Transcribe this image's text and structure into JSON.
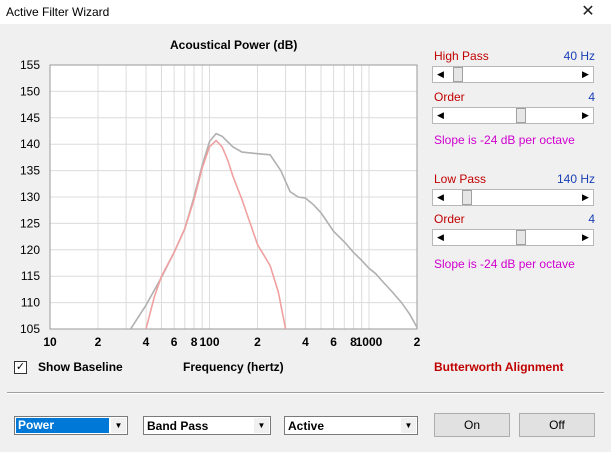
{
  "window": {
    "title": "Active Filter Wizard",
    "close_glyph": "✕"
  },
  "chart_data": {
    "type": "line",
    "title": "Acoustical Power (dB)",
    "xlabel": "Frequency (hertz)",
    "ylabel": "",
    "x_scale": "log",
    "xlim": [
      10,
      2000
    ],
    "ylim": [
      105,
      155
    ],
    "x_ticks": [
      10,
      20,
      40,
      60,
      80,
      100,
      200,
      400,
      600,
      800,
      1000,
      2000
    ],
    "x_tick_labels": [
      "10",
      "2",
      "4",
      "6",
      "8",
      "100",
      "2",
      "4",
      "6",
      "8",
      "1000",
      "2"
    ],
    "y_ticks": [
      105,
      110,
      115,
      120,
      125,
      130,
      135,
      140,
      145,
      150,
      155
    ],
    "grid": true,
    "series": [
      {
        "color": "#b0b0b0",
        "x": [
          32,
          40,
          50,
          60,
          70,
          80,
          90,
          100,
          110,
          120,
          140,
          160,
          200,
          240,
          280,
          320,
          360,
          400,
          450,
          500,
          600,
          700,
          800,
          900,
          1000,
          1100,
          1200,
          1400,
          1600,
          1800,
          2000
        ],
        "y": [
          105,
          109.5,
          114.8,
          119.5,
          124,
          130,
          136,
          140.5,
          142,
          141.5,
          139.5,
          138.5,
          138.2,
          138,
          135,
          131,
          130,
          129.8,
          128.5,
          127,
          123.5,
          121.5,
          119.5,
          118,
          116.5,
          115.5,
          114.2,
          112,
          110,
          107.8,
          105.3
        ]
      },
      {
        "color": "#f0a0a0",
        "x": [
          40,
          45,
          50,
          60,
          70,
          80,
          90,
          100,
          110,
          120,
          130,
          140,
          160,
          180,
          200,
          240,
          270,
          300
        ],
        "y": [
          105,
          111,
          115,
          119.5,
          124,
          129.5,
          135.5,
          139.5,
          140.7,
          139.5,
          137,
          134,
          129.5,
          125,
          121,
          117,
          112,
          105
        ]
      }
    ]
  },
  "controls": {
    "high_pass": {
      "label": "High Pass",
      "value": "40 Hz",
      "position": 0.045
    },
    "high_order": {
      "label": "Order",
      "value": "4",
      "position": 0.57
    },
    "high_slope": "Slope is -24 dB per octave",
    "low_pass": {
      "label": "Low Pass",
      "value": "140 Hz",
      "position": 0.12
    },
    "low_order": {
      "label": "Order",
      "value": "4",
      "position": 0.57
    },
    "low_slope": "Slope is -24 dB per octave"
  },
  "options": {
    "show_baseline_label": "Show Baseline",
    "show_baseline_checked": true,
    "check_glyph": "✓",
    "alignment": "Butterworth Alignment"
  },
  "bottom": {
    "combo1": "Power",
    "combo2": "Band Pass",
    "combo3": "Active",
    "on_label": "On",
    "off_label": "Off",
    "drop_glyph": "▼"
  },
  "glyphs": {
    "left_arrow": "◀",
    "right_arrow": "▶"
  }
}
